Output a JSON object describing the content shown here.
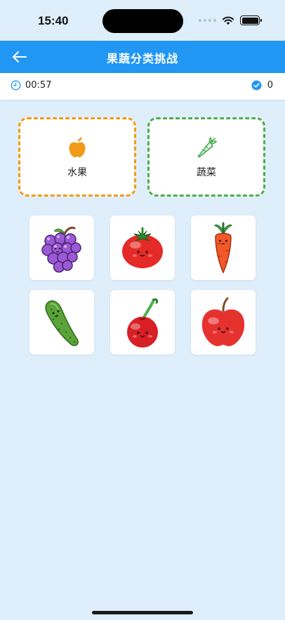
{
  "status_bar": {
    "time": "15:40"
  },
  "nav": {
    "title": "果蔬分类挑战",
    "back_icon": "arrow-left-icon"
  },
  "info": {
    "timer": "00:57",
    "score": "0",
    "timer_icon": "clock-icon",
    "score_icon": "check-circle-icon"
  },
  "categories": [
    {
      "label": "水果",
      "icon": "apple-icon",
      "color": "#f29a1a"
    },
    {
      "label": "蔬菜",
      "icon": "carrot-icon",
      "color": "#4caf50"
    }
  ],
  "items": [
    {
      "name": "grapes-card",
      "icon": "grapes-icon"
    },
    {
      "name": "tomato-card",
      "icon": "tomato-icon"
    },
    {
      "name": "carrot-card",
      "icon": "carrot-icon"
    },
    {
      "name": "cucumber-card",
      "icon": "cucumber-icon"
    },
    {
      "name": "cherry-card",
      "icon": "cherry-icon"
    },
    {
      "name": "apple-card",
      "icon": "apple-icon"
    }
  ],
  "colors": {
    "accent": "#2196f3",
    "background": "#dfeefb",
    "fruit_border": "#f29a1a",
    "veg_border": "#4caf50"
  }
}
